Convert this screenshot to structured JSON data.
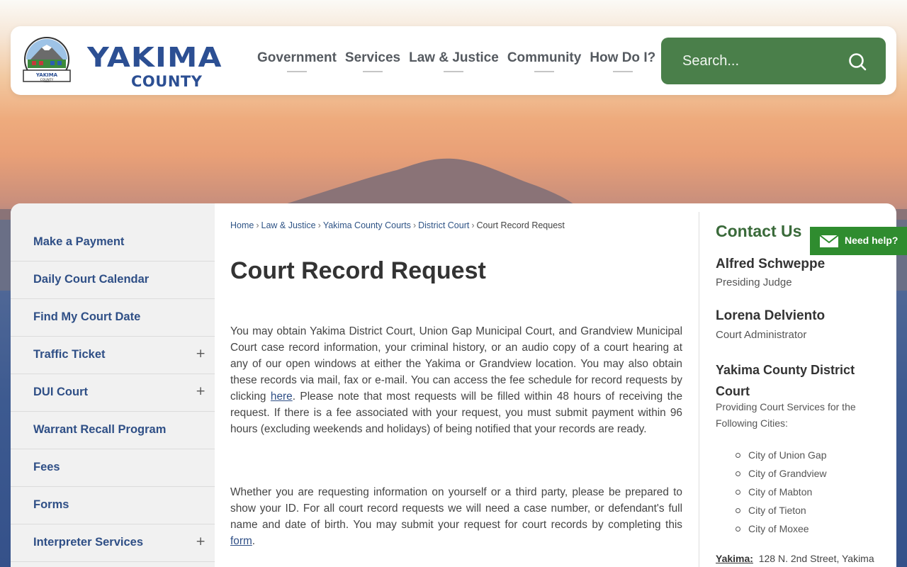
{
  "header": {
    "logo_main": "YAKIMA",
    "logo_sub": "COUNTY",
    "logo_seal_text": "YAKIMA COUNTY",
    "nav": [
      "Government",
      "Services",
      "Law & Justice",
      "Community",
      "How Do I?"
    ],
    "search_placeholder": "Search..."
  },
  "sidebar": {
    "items": [
      {
        "label": "Make a Payment",
        "expand": ""
      },
      {
        "label": "Daily Court Calendar",
        "expand": ""
      },
      {
        "label": "Find My Court Date",
        "expand": ""
      },
      {
        "label": "Traffic Ticket",
        "expand": "+"
      },
      {
        "label": "DUI Court",
        "expand": "+"
      },
      {
        "label": "Warrant Recall Program",
        "expand": ""
      },
      {
        "label": "Fees",
        "expand": ""
      },
      {
        "label": "Forms",
        "expand": ""
      },
      {
        "label": "Interpreter Services",
        "expand": "+"
      }
    ]
  },
  "breadcrumb": {
    "links": [
      "Home",
      "Law & Justice",
      "Yakima County Courts",
      "District Court"
    ],
    "separator": "›",
    "current": "Court Record Request"
  },
  "main": {
    "title": "Court Record Request",
    "para1_a": "You may obtain Yakima District Court, Union Gap Municipal Court, and Grandview Municipal Court case record information, your criminal history, or an audio copy of a court hearing at any of our open windows at either the Yakima or Grandview location. You may also obtain these records via mail, fax or e-mail.  You can access the fee schedule for record requests by clicking ",
    "para1_link": "here",
    "para1_b": ".  Please note that most requests will be filled within 48 hours of receiving the request.  If there is a fee associated with your request, you must submit payment within 96 hours (excluding weekends and holidays) of being notified that your records are ready.",
    "para2_a": "Whether you are requesting information on yourself or a third party, please be prepared to show your ID.  For all court record requests we will need a case number, or defendant's full name and date of birth. You may submit your request for court records by completing this ",
    "para2_link": "form",
    "para2_b": "."
  },
  "contact": {
    "title": "Contact Us",
    "people": [
      {
        "name": "Alfred Schweppe",
        "role": "Presiding Judge"
      },
      {
        "name": "Lorena Delviento",
        "role": "Court Administrator"
      }
    ],
    "court_name": "Yakima County District Court",
    "court_desc": "Providing Court Services for the Following Cities:",
    "cities": [
      "City of Union Gap",
      "City of Grandview",
      "City of Mabton",
      "City of Tieton",
      "City of Moxee"
    ],
    "address_label": "Yakima:",
    "address": "128 N. 2nd Street, Yakima"
  },
  "help": {
    "label": "Need help?"
  },
  "colors": {
    "brand_blue": "#2c4f93",
    "search_green": "#4a7f4a",
    "contact_green": "#3a6a3a",
    "help_green": "#2f8c2f"
  }
}
